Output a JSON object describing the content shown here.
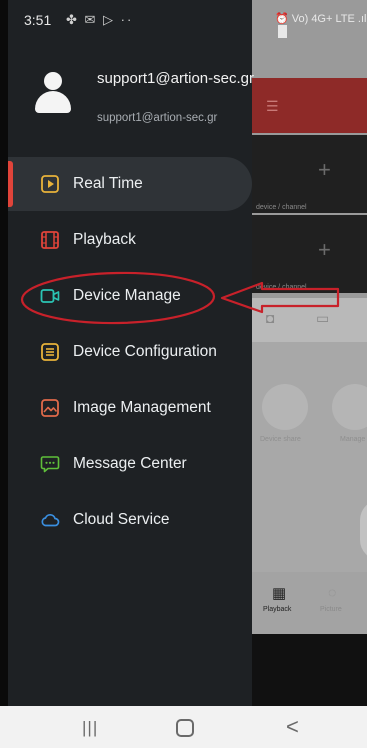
{
  "status_bar": {
    "time": "3:51",
    "notification_icons": "✤ ✉ ▷ ··",
    "right_icons": "⏰ Vo) 4G+ LTE .ıl"
  },
  "profile": {
    "display_name": "support1@artion-sec.gr",
    "email": "support1@artion-sec.gr"
  },
  "menu": {
    "items": [
      {
        "label": "Real Time",
        "icon": "play-square-icon",
        "color": "#e8b23a"
      },
      {
        "label": "Playback",
        "icon": "film-icon",
        "color": "#e0443a"
      },
      {
        "label": "Device Manage",
        "icon": "video-camera-icon",
        "color": "#2bc4b4"
      },
      {
        "label": "Device Configuration",
        "icon": "config-list-icon",
        "color": "#e8b23a"
      },
      {
        "label": "Image Management",
        "icon": "image-icon",
        "color": "#e06a4a"
      },
      {
        "label": "Message Center",
        "icon": "chat-icon",
        "color": "#5fbf3a"
      },
      {
        "label": "Cloud Service",
        "icon": "cloud-icon",
        "color": "#3a8fe0"
      }
    ],
    "selected_index": 0
  },
  "background_app": {
    "tile_caption_1": "device / channel",
    "tile_caption_2": "device / channel",
    "circle_label_1": "Device share",
    "circle_label_2": "Manage",
    "tab_playback": "Playback",
    "tab_other": "Picture",
    "plus_glyph": "+"
  },
  "annotation": {
    "color": "#c8212a"
  },
  "nav_bar": {
    "recents": "|||",
    "back": "<"
  },
  "colors": {
    "drawer_bg": "#1e2124",
    "selected_pill": "#2f3337",
    "accent_red": "#e0443a"
  }
}
